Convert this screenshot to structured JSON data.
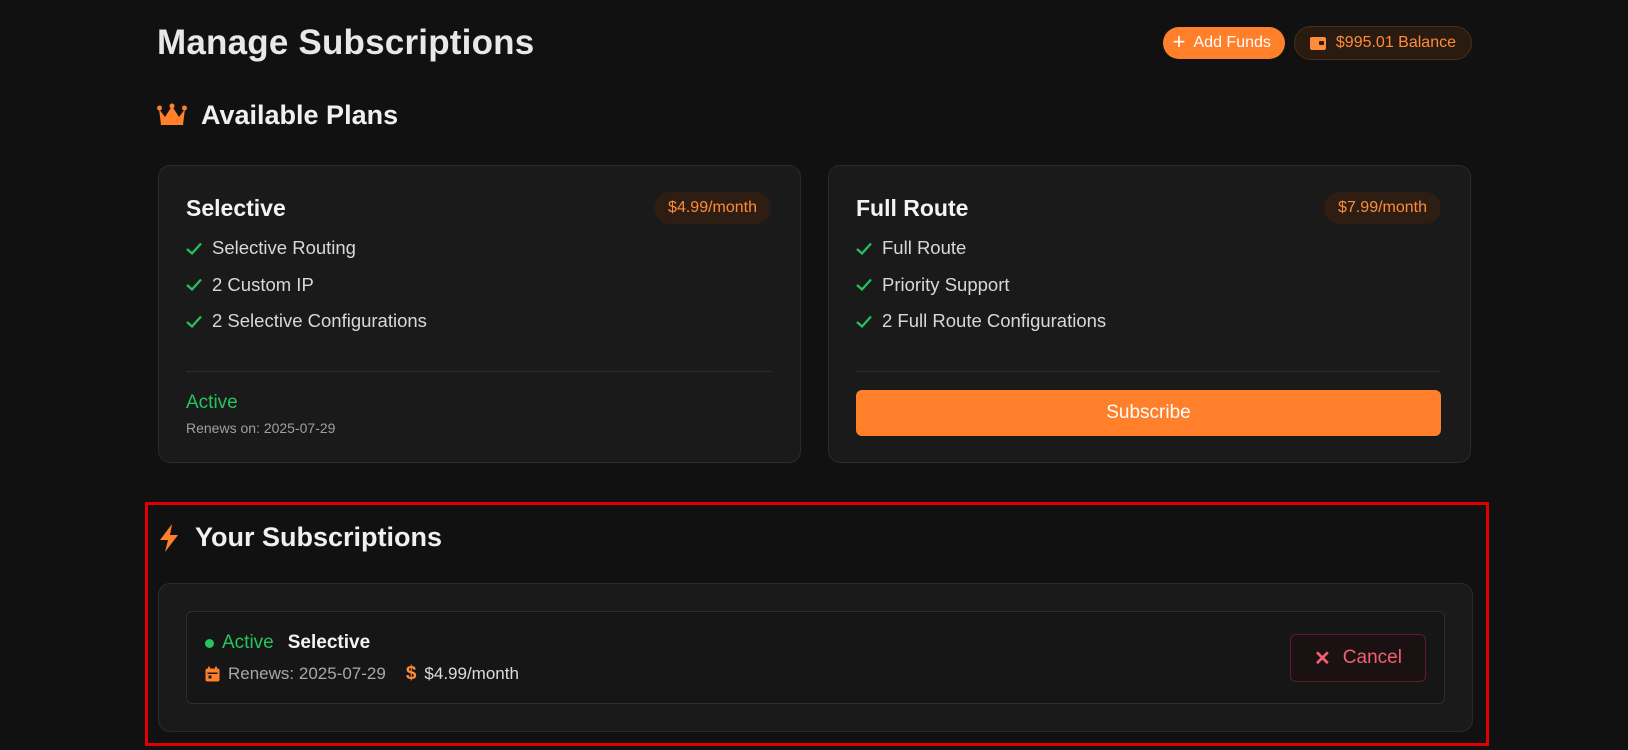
{
  "header": {
    "title": "Manage Subscriptions",
    "add_funds_label": "Add Funds",
    "add_funds_icon": "plus-icon",
    "balance_label": "$995.01 Balance",
    "balance_icon": "wallet-icon"
  },
  "plans_section": {
    "title": "Available Plans",
    "icon": "crown-icon"
  },
  "plans": [
    {
      "name": "Selective",
      "price": "$4.99/month",
      "features": [
        "Selective Routing",
        "2 Custom IP",
        "2 Selective Configurations"
      ],
      "status": "Active",
      "renews": "Renews on: 2025-07-29"
    },
    {
      "name": "Full Route",
      "price": "$7.99/month",
      "features": [
        "Full Route",
        "Priority Support",
        "2 Full Route Configurations"
      ],
      "action_label": "Subscribe"
    }
  ],
  "subscriptions_section": {
    "title": "Your Subscriptions",
    "icon": "bolt-icon"
  },
  "subscriptions": [
    {
      "status": "Active",
      "plan": "Selective",
      "renews": "Renews: 2025-07-29",
      "price_symbol": "$",
      "price": "$4.99/month",
      "cancel_label": "Cancel",
      "cancel_icon": "x-icon"
    }
  ],
  "colors": {
    "accent": "#ff7f2a",
    "active": "#26c35d",
    "danger": "#f06070",
    "highlight": "#e00000",
    "background": "#111111"
  }
}
